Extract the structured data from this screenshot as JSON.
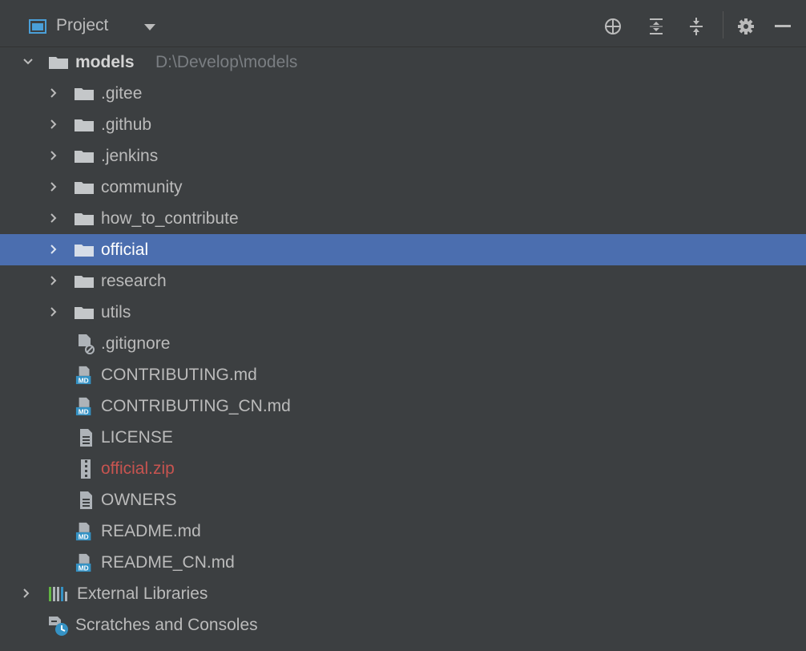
{
  "header": {
    "title": "Project"
  },
  "toolbar": [
    "crosshair-icon",
    "expand-all-icon",
    "collapse-all-icon",
    "gear-icon",
    "minimize-icon"
  ],
  "root": {
    "name": "models",
    "path": "D:\\Develop\\models"
  },
  "folders": [
    ".gitee",
    ".github",
    ".jenkins",
    "community",
    "how_to_contribute",
    "official",
    "research",
    "utils"
  ],
  "selected": "official",
  "files": [
    {
      "name": ".gitignore",
      "icon": "gitignore-file-icon"
    },
    {
      "name": "CONTRIBUTING.md",
      "icon": "markdown-file-icon"
    },
    {
      "name": "CONTRIBUTING_CN.md",
      "icon": "markdown-file-icon"
    },
    {
      "name": "LICENSE",
      "icon": "text-file-icon"
    },
    {
      "name": "official.zip",
      "icon": "zip-file-icon",
      "color": "#c75450"
    },
    {
      "name": "OWNERS",
      "icon": "text-file-icon"
    },
    {
      "name": "README.md",
      "icon": "markdown-file-icon"
    },
    {
      "name": "README_CN.md",
      "icon": "markdown-file-icon"
    }
  ],
  "external": {
    "label": "External Libraries"
  },
  "scratches": {
    "label": "Scratches and Consoles"
  },
  "colors": {
    "background": "#3c3f41",
    "selection": "#4b6eaf",
    "text": "#bbbbbb",
    "error": "#c75450",
    "md_badge": "#3592c4"
  }
}
